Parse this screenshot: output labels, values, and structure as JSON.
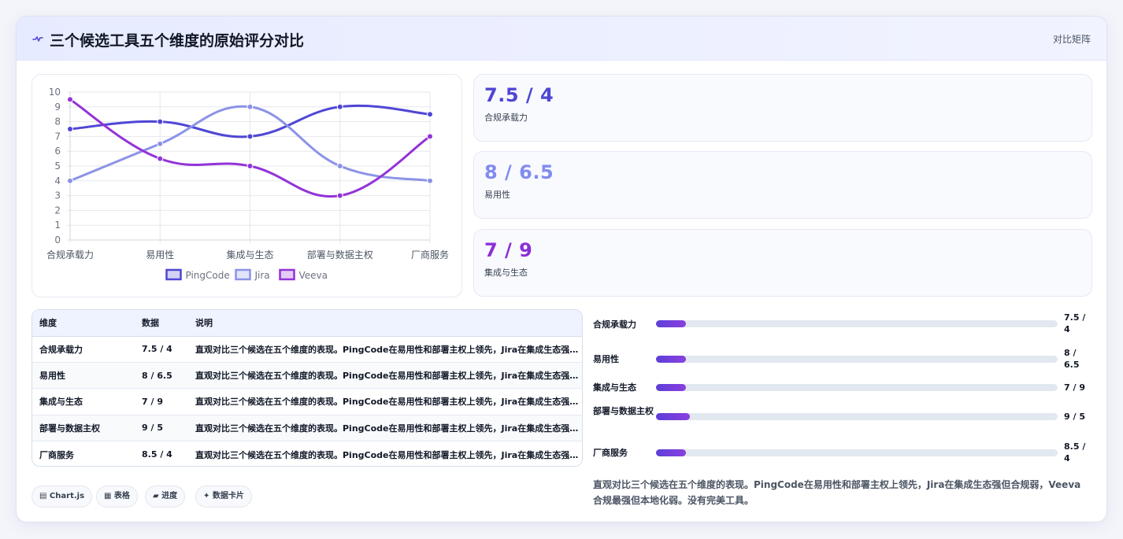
{
  "header": {
    "title": "三个候选工具五个维度的原始评分对比",
    "tag": "对比矩阵"
  },
  "chart_data": {
    "type": "line",
    "categories": [
      "合规承载力",
      "易用性",
      "集成与生态",
      "部署与数据主权",
      "厂商服务"
    ],
    "ylim": [
      0,
      10
    ],
    "yticks": [
      0,
      1,
      2,
      3,
      4,
      5,
      6,
      7,
      8,
      9,
      10
    ],
    "grid": true,
    "legend": "bottom",
    "series": [
      {
        "name": "PingCode",
        "color": "#4f46d5",
        "values": [
          7.5,
          8,
          7,
          9,
          8.5
        ]
      },
      {
        "name": "Jira",
        "color": "#8b93e6",
        "values": [
          4,
          6.5,
          9,
          5,
          4
        ]
      },
      {
        "name": "Veeva",
        "color": "#9333d8",
        "values": [
          9.5,
          5.5,
          5,
          3,
          7
        ]
      }
    ]
  },
  "stats": [
    {
      "value": "7.5 / 4",
      "label": "合规承载力",
      "color": "#4f46d5"
    },
    {
      "value": "8 / 6.5",
      "label": "易用性",
      "color": "#818cf0"
    },
    {
      "value": "7 / 9",
      "label": "集成与生态",
      "color": "#8b2fd6"
    }
  ],
  "table": {
    "headers": [
      "维度",
      "数据",
      "说明"
    ],
    "rows": [
      {
        "dim": "合规承载力",
        "data": "7.5 / 4",
        "desc": "直观对比三个候选在五个维度的表现。PingCode在易用性和部署主权上领先，Jira在集成生态强但合规弱，Veeva合规最强但本地化弱。没有完美工具。"
      },
      {
        "dim": "易用性",
        "data": "8 / 6.5",
        "desc": "直观对比三个候选在五个维度的表现。PingCode在易用性和部署主权上领先，Jira在集成生态强但合规弱，Veeva合规最强但本地化弱。没有完美工具。"
      },
      {
        "dim": "集成与生态",
        "data": "7 / 9",
        "desc": "直观对比三个候选在五个维度的表现。PingCode在易用性和部署主权上领先，Jira在集成生态强但合规弱，Veeva合规最强但本地化弱。没有完美工具。"
      },
      {
        "dim": "部署与数据主权",
        "data": "9 / 5",
        "desc": "直观对比三个候选在五个维度的表现。PingCode在易用性和部署主权上领先，Jira在集成生态强但合规弱，Veeva合规最强但本地化弱。没有完美工具。"
      },
      {
        "dim": "厂商服务",
        "data": "8.5 / 4",
        "desc": "直观对比三个候选在五个维度的表现。PingCode在易用性和部署主权上领先，Jira在集成生态强但合规弱，Veeva合规最强但本地化弱。没有完美工具。"
      }
    ]
  },
  "progress": [
    {
      "label": "合规承载力",
      "value": "7.5 / 4",
      "fraction": 0.075
    },
    {
      "label": "易用性",
      "value": "8 / 6.5",
      "fraction": 0.075
    },
    {
      "label": "集成与生态",
      "value": "7 / 9",
      "fraction": 0.075
    },
    {
      "label": "部署与数据主权",
      "value": "9 / 5",
      "fraction": 0.085
    },
    {
      "label": "厂商服务",
      "value": "8.5 / 4",
      "fraction": 0.075
    }
  ],
  "summary": "直观对比三个候选在五个维度的表现。PingCode在易用性和部署主权上领先，Jira在集成生态强但合规弱，Veeva合规最强但本地化弱。没有完美工具。",
  "chips": [
    {
      "icon": "chart-icon",
      "label": "▤ Chart.js"
    },
    {
      "icon": "table-icon",
      "label": "▦ 表格"
    },
    {
      "icon": "progress-icon",
      "label": "▰ 进度"
    },
    {
      "icon": "sparkle-icon",
      "label": "✦ 数据卡片"
    }
  ]
}
